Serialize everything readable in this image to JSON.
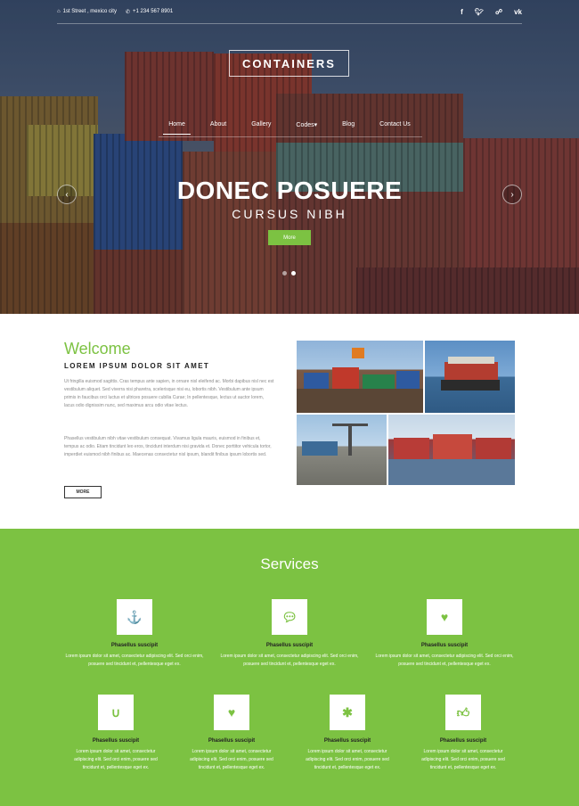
{
  "topbar": {
    "address": "1st Street , mexico city",
    "phone": "+1 234 567 8901",
    "social": [
      "f",
      "t",
      "rss",
      "vk"
    ]
  },
  "logo": "CONTAINERS",
  "nav": {
    "items": [
      "Home",
      "About",
      "Gallery",
      "Codes",
      "Blog",
      "Contact Us"
    ],
    "active": "Home",
    "dropdown_caret": "▾"
  },
  "slider": {
    "title": "DONEC POSUERE",
    "subtitle": "CURSUS NIBH",
    "button": "More",
    "prev": "‹",
    "next": "›",
    "active_dot": 2,
    "dot_count": 2
  },
  "welcome": {
    "heading": "Welcome",
    "subheading": "LOREM IPSUM DOLOR SIT AMET",
    "p1": "Ut fringilla euismod sagittis. Cras tempus ante sapien, in ornare nisl eleifend ac. Morbi dapibus nisl nec est vestibulum aliquet. Sed viverra nisi pharetra, scelerisque nisi eu, lobortis nibh. Vestibulum ante ipsum primis in faucibus orci luctus et ultrices posuere cubilia Curae; In pellentesque, lectus ut auctor lorem, lacus odio dignissim nunc, sed maximus arcu odio vitae lectus.",
    "p2": "Phasellus vestibulum nibh vitae vestibulum consequat. Vivamus ligula mauris, euismod in finibus et, tempus ac odio. Etiam tincidunt leo eros, tincidunt interdum nisi gravida et. Donec porttitor vehicula tortor, imperdiet euismod nibh finibus ac. Maecenas consectetur nisl ipsum, blandit finibus ipsum lobortis sed.",
    "button": "MORE"
  },
  "services": {
    "heading": "Services",
    "row1": [
      {
        "icon": "anchor-icon",
        "title": "Phasellus suscipit",
        "text": "Lorem ipsum dolor sit amet, consectetur adipiscing elit. Sed orci enim, posuere sed tincidunt et, pellentesque eget ex."
      },
      {
        "icon": "chat-icon",
        "title": "Phasellus suscipit",
        "text": "Lorem ipsum dolor sit amet, consectetur adipiscing elit. Sed orci enim, posuere sed tincidunt et, pellentesque eget ex."
      },
      {
        "icon": "heartbeat-icon",
        "title": "Phasellus suscipit",
        "text": "Lorem ipsum dolor sit amet, consectetur adipiscing elit. Sed orci enim, posuere sed tincidunt et, pellentesque eget ex."
      }
    ],
    "row2": [
      {
        "icon": "magnet-icon",
        "title": "Phasellus suscipit",
        "text": "Lorem ipsum dolor sit amet, consectetur adipiscing elit. Sed orci enim, posuere sed tincidunt et, pellentesque eget ex."
      },
      {
        "icon": "heartbeat-icon",
        "title": "Phasellus suscipit",
        "text": "Lorem ipsum dolor sit amet, consectetur adipiscing elit. Sed orci enim, posuere sed tincidunt et, pellentesque eget ex."
      },
      {
        "icon": "asterisk-icon",
        "title": "Phasellus suscipit",
        "text": "Lorem ipsum dolor sit amet, consectetur adipiscing elit. Sed orci enim, posuere sed tincidunt et, pellentesque eget ex."
      },
      {
        "icon": "thumbs-up-icon",
        "title": "Phasellus suscipit",
        "text": "Lorem ipsum dolor sit amet, consectetur adipiscing elit. Sed orci enim, posuere sed tincidunt et, pellentesque eget ex."
      }
    ]
  },
  "colors": {
    "accent": "#7cc242",
    "dark": "#222222",
    "muted_text": "#8a8a8a"
  }
}
